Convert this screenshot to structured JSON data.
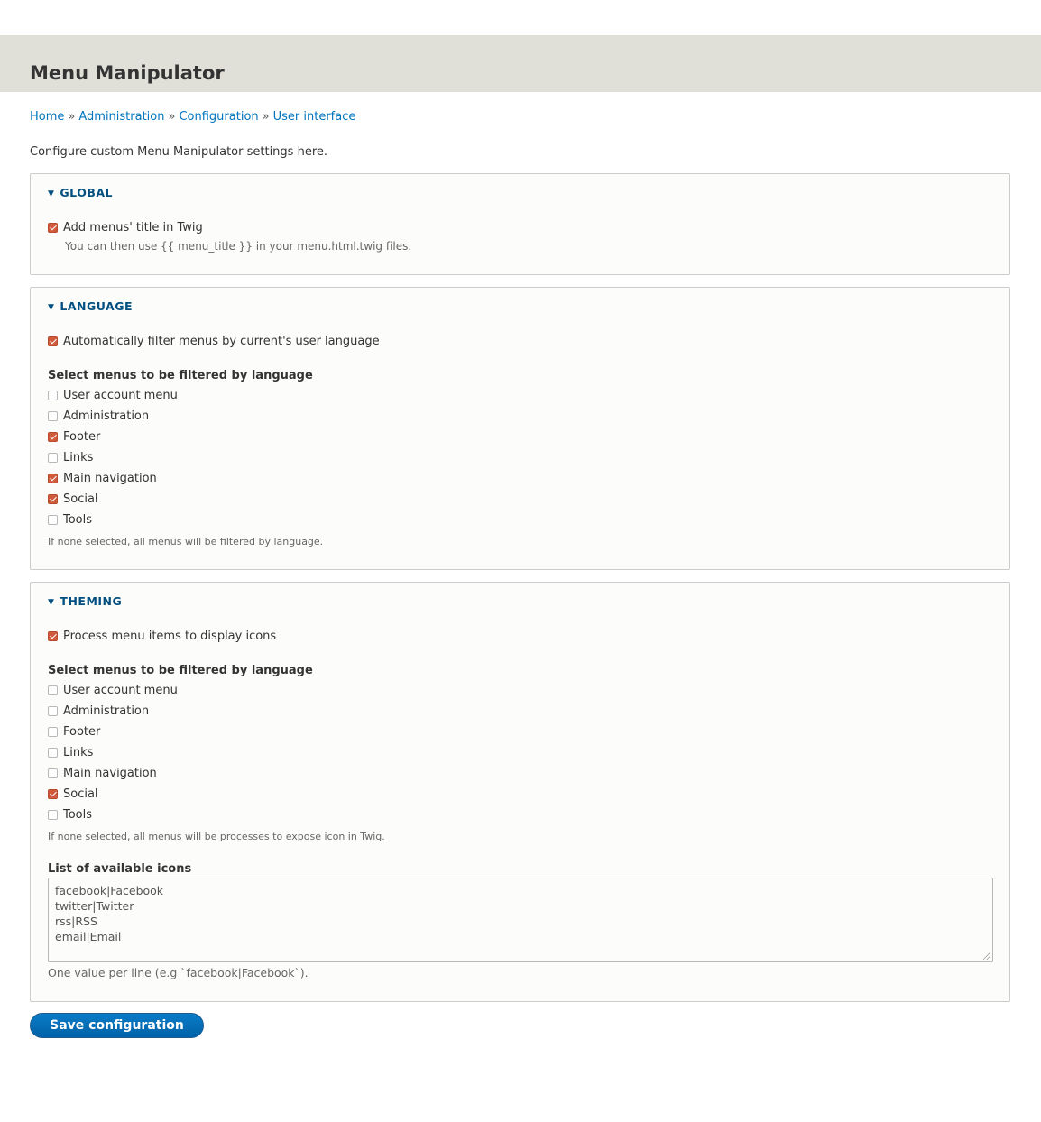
{
  "page": {
    "title": "Menu Manipulator"
  },
  "breadcrumb": [
    "Home",
    "Administration",
    "Configuration",
    "User interface"
  ],
  "breadcrumb_separator": "»",
  "intro": "Configure custom Menu Manipulator settings here.",
  "global": {
    "legend": "GLOBAL",
    "add_title": {
      "label": "Add menus' title in Twig",
      "checked": true
    },
    "add_title_description": "You can then use {{ menu_title }} in your menu.html.twig files."
  },
  "language": {
    "legend": "LANGUAGE",
    "auto_filter": {
      "label": "Automatically filter menus by current's user language",
      "checked": true
    },
    "group_label": "Select menus to be filtered by language",
    "menus": [
      {
        "label": "User account menu",
        "checked": false
      },
      {
        "label": "Administration",
        "checked": false
      },
      {
        "label": "Footer",
        "checked": true
      },
      {
        "label": "Links",
        "checked": false
      },
      {
        "label": "Main navigation",
        "checked": true
      },
      {
        "label": "Social",
        "checked": true
      },
      {
        "label": "Tools",
        "checked": false
      }
    ],
    "description": "If none selected, all menus will be filtered by language."
  },
  "theming": {
    "legend": "THEMING",
    "process_icons": {
      "label": "Process menu items to display icons",
      "checked": true
    },
    "group_label": "Select menus to be filtered by language",
    "menus": [
      {
        "label": "User account menu",
        "checked": false
      },
      {
        "label": "Administration",
        "checked": false
      },
      {
        "label": "Footer",
        "checked": false
      },
      {
        "label": "Links",
        "checked": false
      },
      {
        "label": "Main navigation",
        "checked": false
      },
      {
        "label": "Social",
        "checked": true
      },
      {
        "label": "Tools",
        "checked": false
      }
    ],
    "description": "If none selected, all menus will be processes to expose icon in Twig.",
    "icons_label": "List of available icons",
    "icons_value": "facebook|Facebook\ntwitter|Twitter\nrss|RSS\nemail|Email",
    "icons_description": "One value per line (e.g `facebook|Facebook`)."
  },
  "actions": {
    "save_label": "Save configuration"
  },
  "colors": {
    "link": "#0074bd",
    "legend": "#004f80",
    "checkbox_checked": "#d05b3c",
    "button": "#0071b8",
    "header_bg": "#e0e0d8"
  }
}
